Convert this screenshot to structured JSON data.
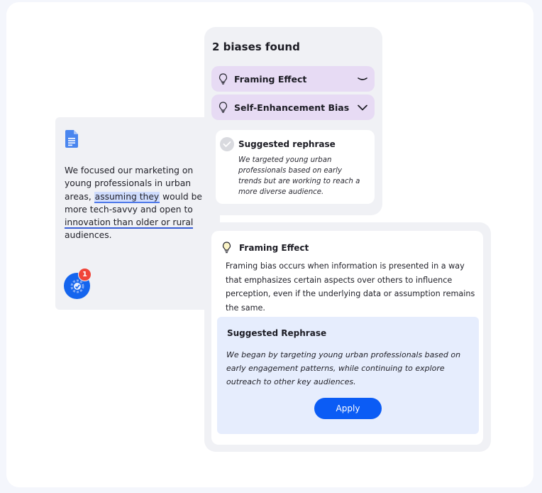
{
  "doc": {
    "text_before": "We focused our marketing on young professionals in urban areas, ",
    "highlight_1": "assuming they",
    "text_middle": " would be more tech-savvy and open to ",
    "highlight_2": "innovation than older or rural",
    "text_after": " audiences.",
    "notification_count": "1",
    "icon": "google-docs-icon"
  },
  "biases": {
    "title": "2 biases found",
    "items": [
      {
        "label": "Framing Effect",
        "icon": "lightbulb-icon",
        "state": "expanded"
      },
      {
        "label": "Self-Enhancement Bias",
        "icon": "lightbulb-icon",
        "state": "collapsed"
      }
    ],
    "suggested": {
      "title": "Suggested rephrase",
      "text": "We targeted young urban professionals based on early trends but are working to reach a more diverse audience."
    }
  },
  "detail": {
    "title": "Framing Effect",
    "description": "Framing bias occurs when information is presented in a way that emphasizes certain aspects over others to influence perception, even if the underlying data or assumption remains the same.",
    "suggestion": {
      "title": "Suggested Rephrase",
      "text": "We began by targeting young urban professionals based on early engagement patterns, while continuing to explore outreach to other key audiences.",
      "button": "Apply"
    }
  },
  "colors": {
    "accent": "#0b5cf5",
    "bias_row": "#e7dbf4",
    "suggest_bg": "#e6edfd",
    "badge": "#f04438"
  }
}
